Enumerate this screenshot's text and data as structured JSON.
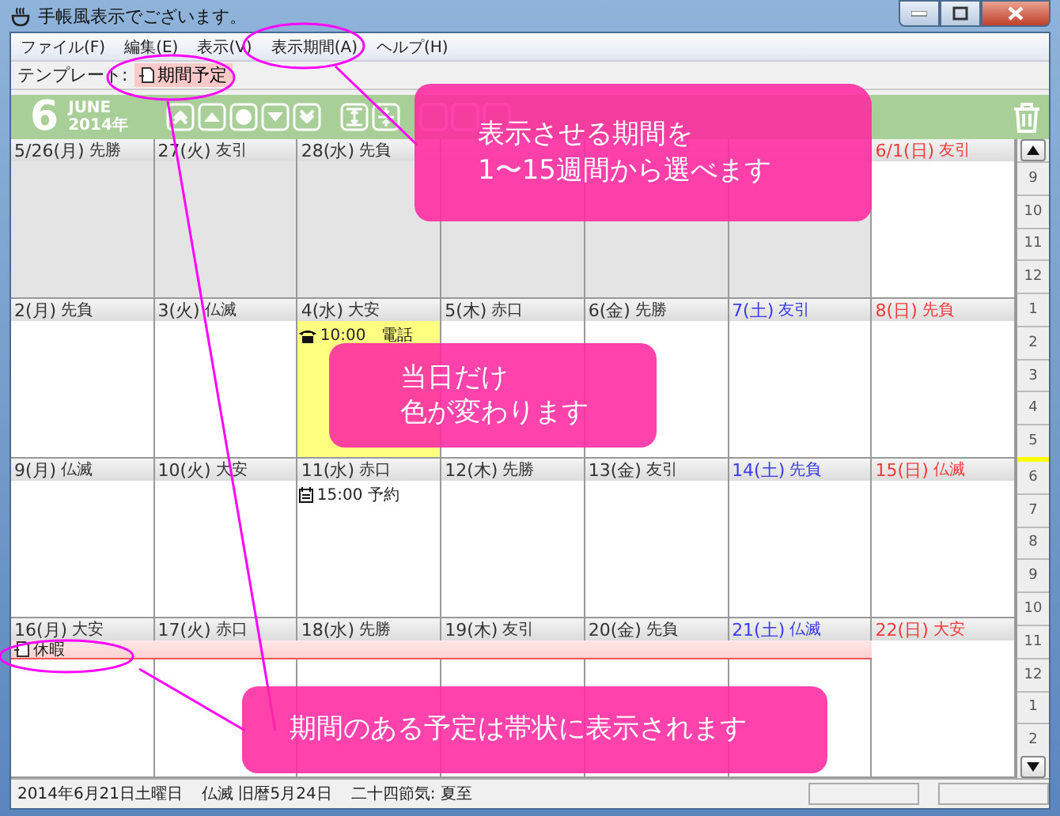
{
  "window": {
    "title": "手帳風表示でございます。"
  },
  "menu": [
    {
      "label": "ファイル(F)"
    },
    {
      "label": "編集(E)"
    },
    {
      "label": "表示(V)"
    },
    {
      "label": "表示期間(A)"
    },
    {
      "label": "ヘルプ(H)"
    }
  ],
  "template_bar": {
    "label": "テンプレート:",
    "chip": "期間予定"
  },
  "header": {
    "month": "6",
    "month_name": "JUNE",
    "year": "2014年"
  },
  "weeks": [
    {
      "days": [
        {
          "date": "5/26(月)",
          "rokuyo": "先勝",
          "kind": "weekday",
          "outside": true,
          "today": false
        },
        {
          "date": "27(火)",
          "rokuyo": "友引",
          "kind": "weekday",
          "outside": true,
          "today": false
        },
        {
          "date": "28(水)",
          "rokuyo": "先負",
          "kind": "weekday",
          "outside": true,
          "today": false
        },
        {
          "kind": "weekday",
          "outside": true,
          "today": false
        },
        {
          "kind": "weekday",
          "outside": true,
          "today": false
        },
        {
          "kind": "sat",
          "outside": true,
          "today": false
        },
        {
          "date": "6/1(日)",
          "rokuyo": "友引",
          "kind": "sun",
          "outside": false,
          "today": false
        }
      ]
    },
    {
      "days": [
        {
          "date": "2(月)",
          "rokuyo": "先負",
          "kind": "weekday",
          "outside": false,
          "today": false
        },
        {
          "date": "3(火)",
          "rokuyo": "仏滅",
          "kind": "weekday",
          "outside": false,
          "today": false
        },
        {
          "date": "4(水)",
          "rokuyo": "大安",
          "kind": "weekday",
          "outside": false,
          "today": true,
          "events": [
            {
              "kind": "phone",
              "text": "10:00　電話"
            }
          ]
        },
        {
          "date": "5(木)",
          "rokuyo": "赤口",
          "kind": "weekday",
          "outside": false,
          "today": false
        },
        {
          "date": "6(金)",
          "rokuyo": "先勝",
          "kind": "weekday",
          "outside": false,
          "today": false
        },
        {
          "date": "7(土)",
          "rokuyo": "友引",
          "kind": "sat",
          "outside": false,
          "today": false
        },
        {
          "date": "8(日)",
          "rokuyo": "先負",
          "kind": "sun",
          "outside": false,
          "today": false
        }
      ]
    },
    {
      "days": [
        {
          "date": "9(月)",
          "rokuyo": "仏滅",
          "kind": "weekday",
          "outside": false,
          "today": false
        },
        {
          "date": "10(火)",
          "rokuyo": "大安",
          "kind": "weekday",
          "outside": false,
          "today": false
        },
        {
          "date": "11(水)",
          "rokuyo": "赤口",
          "kind": "weekday",
          "outside": false,
          "today": false,
          "events": [
            {
              "kind": "memo",
              "text": "15:00 予約"
            }
          ]
        },
        {
          "date": "12(木)",
          "rokuyo": "先勝",
          "kind": "weekday",
          "outside": false,
          "today": false
        },
        {
          "date": "13(金)",
          "rokuyo": "友引",
          "kind": "weekday",
          "outside": false,
          "today": false
        },
        {
          "date": "14(土)",
          "rokuyo": "先負",
          "kind": "sat",
          "outside": false,
          "today": false
        },
        {
          "date": "15(日)",
          "rokuyo": "仏滅",
          "kind": "sun",
          "outside": false,
          "today": false
        }
      ]
    },
    {
      "band_label": "休暇",
      "days": [
        {
          "date": "16(月)",
          "rokuyo": "大安",
          "kind": "weekday",
          "outside": false,
          "today": false,
          "in_band": true
        },
        {
          "date": "17(火)",
          "rokuyo": "赤口",
          "kind": "weekday",
          "outside": false,
          "today": false,
          "in_band": true
        },
        {
          "date": "18(水)",
          "rokuyo": "先勝",
          "kind": "weekday",
          "outside": false,
          "today": false,
          "in_band": true
        },
        {
          "date": "19(木)",
          "rokuyo": "友引",
          "kind": "weekday",
          "outside": false,
          "today": false,
          "in_band": true
        },
        {
          "date": "20(金)",
          "rokuyo": "先負",
          "kind": "weekday",
          "outside": false,
          "today": false,
          "in_band": true
        },
        {
          "date": "21(土)",
          "rokuyo": "仏滅",
          "kind": "sat",
          "outside": false,
          "today": false,
          "in_band": true
        },
        {
          "date": "22(日)",
          "rokuyo": "大安",
          "kind": "sun",
          "outside": false,
          "today": false,
          "in_band": false
        }
      ]
    }
  ],
  "month_strip": [
    {
      "label": "9",
      "selected": false
    },
    {
      "label": "10",
      "selected": false
    },
    {
      "label": "11",
      "selected": false
    },
    {
      "label": "12",
      "selected": false
    },
    {
      "label": "1",
      "selected": false
    },
    {
      "label": "2",
      "selected": false
    },
    {
      "label": "3",
      "selected": false
    },
    {
      "label": "4",
      "selected": false
    },
    {
      "label": "5",
      "selected": false
    },
    {
      "label": "6",
      "selected": true
    },
    {
      "label": "7",
      "selected": false
    },
    {
      "label": "8",
      "selected": false
    },
    {
      "label": "9",
      "selected": false
    },
    {
      "label": "10",
      "selected": false
    },
    {
      "label": "11",
      "selected": false
    },
    {
      "label": "12",
      "selected": false
    },
    {
      "label": "1",
      "selected": false
    },
    {
      "label": "2",
      "selected": false
    }
  ],
  "status_bar": {
    "date": "2014年6月21日土曜日",
    "lunar": "仏滅 旧暦5月24日",
    "solar_term": "二十四節気: 夏至"
  },
  "callouts": [
    {
      "lines": [
        "表示させる期間を",
        "1〜15週間から選べます"
      ]
    },
    {
      "lines": [
        "当日だけ",
        "色が変わります"
      ]
    },
    {
      "lines": [
        "期間のある予定は帯状に表示されます"
      ]
    }
  ]
}
